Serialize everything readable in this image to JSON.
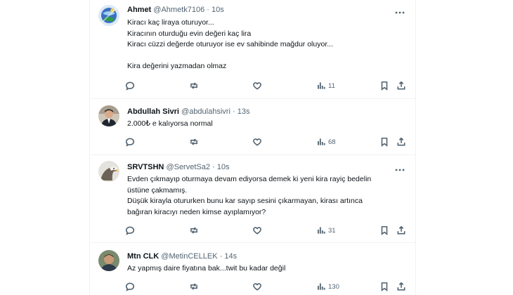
{
  "tweets": [
    {
      "name": "Ahmet",
      "handle": "@Ahmetk7106",
      "time": "10s",
      "separator": "·",
      "lines": [
        "Kiracı kaç liraya oturuyor...",
        "Kiracının oturduğu evin değeri kaç lira",
        "Kiracı cüzzi değerde oturuyor ise ev sahibinde mağdur oluyor...",
        "",
        "Kira değerini yazmadan olmaz"
      ],
      "views": "11",
      "avatar_icon": "avatar-globe-image"
    },
    {
      "name": "Abdullah Sivri",
      "handle": "@abdulahsivri",
      "time": "13s",
      "separator": "·",
      "lines": [
        "2.000₺ e kalıyorsa normal"
      ],
      "views": "68",
      "avatar_icon": "avatar-person-suit-image"
    },
    {
      "name": "SRVTSHN",
      "handle": "@ServetSa2",
      "time": "10s",
      "separator": "·",
      "lines": [
        "Evden çıkmayıp oturmaya devam ediyorsa demek ki yeni kira rayiç bedelin",
        "üstüne çakmamış.",
        "Düşük kirayla otururken bunu kar sayıp sesini çıkarmayan, kirası artınca",
        "bağıran kiracıyı neden kimse ayıplamıyor?"
      ],
      "views": "31",
      "avatar_icon": "avatar-eagle-image"
    },
    {
      "name": "Mtn CLK",
      "handle": "@MetinCELLEK",
      "time": "14s",
      "separator": "·",
      "lines": [
        "Az yapmış daire fiyatına bak...twit bu kadar değil"
      ],
      "views": "130",
      "avatar_icon": "avatar-person-portrait-image"
    }
  ],
  "icons": {
    "reply": "reply-icon",
    "retweet": "retweet-icon",
    "like": "like-icon",
    "views": "views-icon",
    "bookmark": "bookmark-icon",
    "share": "share-icon",
    "more": "more-icon"
  },
  "colors": {
    "text": "#0f1419",
    "secondary": "#536471",
    "divider": "#eff3f4"
  }
}
